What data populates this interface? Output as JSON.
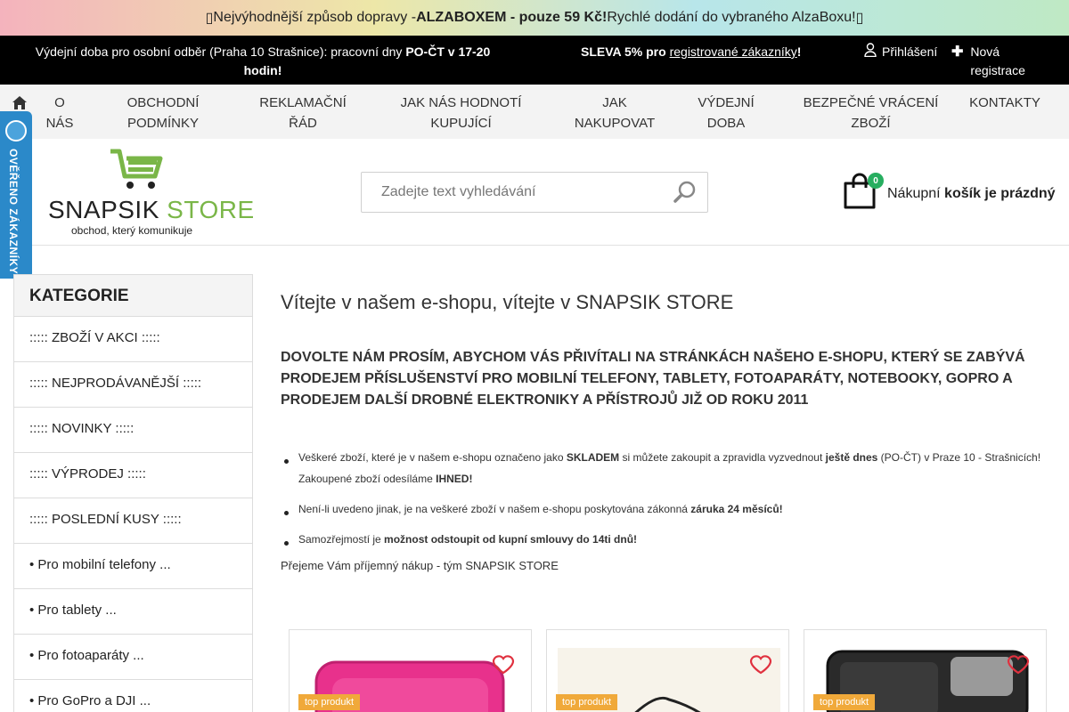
{
  "banner": {
    "icon_left": "truck-icon",
    "prefix": " Nejvýhodnější způsob dopravy - ",
    "highlight": "ALZABOXEM - pouze 59 Kč!",
    "suffix": " Rychlé dodání do vybraného AlzaBoxu! ",
    "icon_right": "truck-icon"
  },
  "topbar": {
    "pickup_prefix": "Výdejní doba pro osobní odběr (Praha 10 Strašnice): pracovní dny ",
    "pickup_bold": "PO-ČT v 17-20 hodin!",
    "sale_bold": "SLEVA 5% pro ",
    "sale_link": "registrované zákazníky",
    "sale_end": "!",
    "login": "Přihlášení",
    "register": "Nová registrace"
  },
  "nav": {
    "home_icon": "home-icon",
    "items": [
      "O nás",
      "Obchodní podmínky",
      "Reklamační řád",
      "Jak nás hodnotí kupující",
      "Jak nakupovat",
      "Výdejní doba",
      "Bezpečné vrácení zboží",
      "Kontakty"
    ]
  },
  "logo": {
    "word1": "SNAPSIK",
    "word2": " STORE",
    "tagline": "obchod, který komunikuje"
  },
  "search": {
    "placeholder": "Zadejte text vyhledávání"
  },
  "cart": {
    "count": "0",
    "label": "Nákupní ",
    "status": "košík je prázdný"
  },
  "verified": {
    "label": "OVĚŘENO ZÁKAZNÍKY"
  },
  "sidebar": {
    "title": "KATEGORIE",
    "items": [
      "::::: ZBOŽÍ V AKCI :::::",
      "::::: NEJPRODÁVANĚJŠÍ :::::",
      "::::: NOVINKY :::::",
      "::::: VÝPRODEJ :::::",
      "::::: POSLEDNÍ KUSY :::::",
      "• Pro mobilní telefony ...",
      "• Pro tablety ...",
      "• Pro fotoaparáty ...",
      "• Pro GoPro a DJI ..."
    ]
  },
  "main": {
    "title": "Vítejte v našem e-shopu, vítejte v SNAPSIK STORE",
    "headline": "Dovolte nám prosím, abychom vás přivítali na stránkách našeho e-shopu, který se zabývá prodejem příslušenství pro mobilní telefony, tablety, fotoaparáty, notebooky, GoPro a prodejem další drobné elektroniky a přístrojů již od roku 2011",
    "bullets": [
      {
        "a": "Veškeré zboží, které je v našem e-shopu označeno jako ",
        "b": "SKLADEM",
        "c": " si můžete zakoupit a zpravidla vyzvednout ",
        "d": "ještě dnes",
        "e": " (PO-ČT) v Praze 10 - Strašnicích! Zakoupené zboží odesíláme ",
        "f": "IHNED!"
      },
      {
        "a": "Není-li uvedeno jinak, je na veškeré zboží v našem e-shopu poskytována zákonná ",
        "b": "záruka 24 měsíců!"
      },
      {
        "a": "Samozřejmostí je ",
        "b": "možnost odstoupit od kupní smlouvy do 14ti dnů!"
      }
    ],
    "thanks": "Přejeme Vám příjemný nákup - tým SNAPSIK STORE"
  },
  "products": [
    {
      "tag": "top produkt",
      "icon": "heart-icon"
    },
    {
      "tag": "top produkt",
      "icon": "heart-icon"
    },
    {
      "tag": "top produkt",
      "icon": "heart-icon"
    }
  ],
  "colors": {
    "accent_green": "#7ab648",
    "badge_green": "#27ae60",
    "verified_blue": "#2b89c9",
    "tag_orange": "#f0a93a",
    "heart_red": "#e0313f"
  }
}
